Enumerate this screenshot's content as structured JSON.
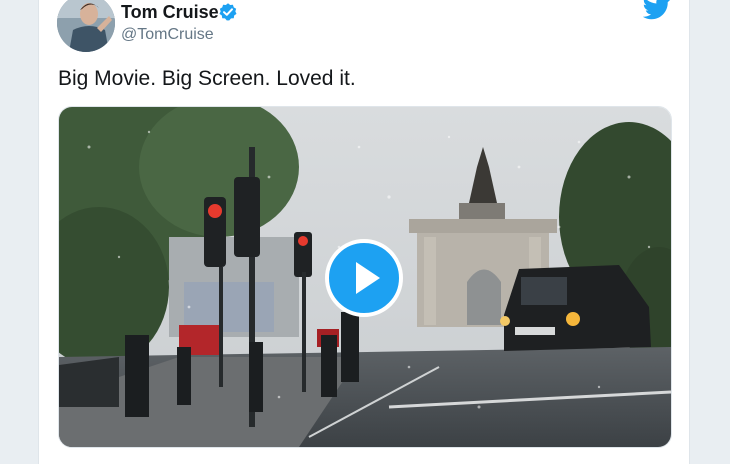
{
  "tweet": {
    "author_name": "Tom Cruise",
    "author_handle": "@TomCruise",
    "verified": true,
    "text": "Big Movie. Big Screen. Loved it."
  },
  "icons": {
    "verified": "verified-badge-icon",
    "brand": "twitter-bird-icon",
    "play": "play-icon"
  },
  "colors": {
    "brand_blue": "#1da1f2",
    "text_primary": "#14171a",
    "text_secondary": "#657786"
  }
}
